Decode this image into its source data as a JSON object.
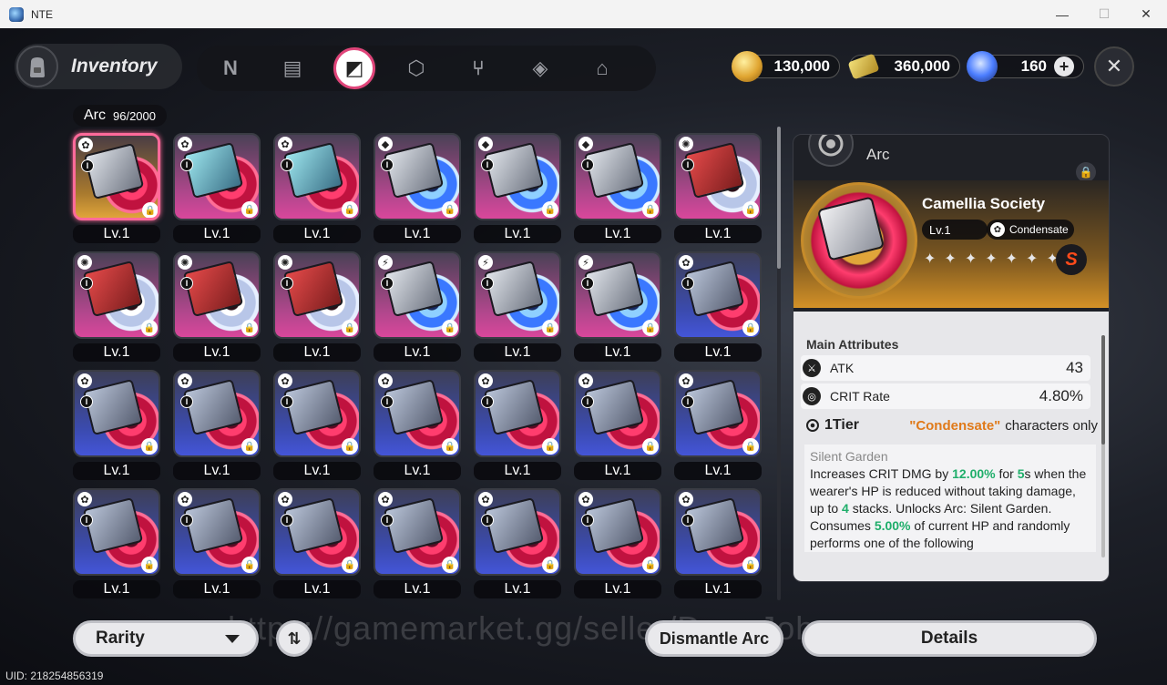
{
  "window": {
    "title": "NTE",
    "minimize": "—",
    "maximize": "☐",
    "close": "✕"
  },
  "header": {
    "inventory_label": "Inventory",
    "tabs": [
      {
        "icon": "n-logo-icon",
        "glyph": "N"
      },
      {
        "icon": "gameboy-icon",
        "glyph": "▤"
      },
      {
        "icon": "arc-cartridge-icon",
        "glyph": "◩",
        "active": true
      },
      {
        "icon": "box-icon",
        "glyph": "⬡"
      },
      {
        "icon": "fork-knife-icon",
        "glyph": "⑂"
      },
      {
        "icon": "cube-icon",
        "glyph": "◈"
      },
      {
        "icon": "house-icon",
        "glyph": "⌂"
      }
    ],
    "currencies": [
      {
        "icon": "gold-coin-icon",
        "value": "130,000",
        "color": "#e0a531"
      },
      {
        "icon": "ticket-icon",
        "value": "360,000",
        "color": "#d8c24a"
      },
      {
        "icon": "crystal-icon",
        "value": "160",
        "color": "#4b7dff",
        "plus": "+"
      }
    ],
    "close_glyph": "✕"
  },
  "arc_count": {
    "label": "Arc",
    "count": "96/2000"
  },
  "grid": {
    "level_text": "Lv.1",
    "tier_mark": "I",
    "rows": [
      [
        {
          "style": "gold",
          "cart": "silver",
          "disc": "",
          "badge": "✿",
          "selected": true
        },
        {
          "style": "pink",
          "cart": "teal",
          "disc": "",
          "badge": "✿"
        },
        {
          "style": "pink",
          "cart": "teal",
          "disc": "",
          "badge": "✿"
        },
        {
          "style": "pink",
          "cart": "silver",
          "disc": "blueglow",
          "badge": "◆"
        },
        {
          "style": "pink",
          "cart": "silver",
          "disc": "blueglow",
          "badge": "◆"
        },
        {
          "style": "pink",
          "cart": "silver",
          "disc": "blueglow",
          "badge": "◆"
        },
        {
          "style": "pink",
          "cart": "red",
          "disc": "swirl",
          "badge": "✺"
        }
      ],
      [
        {
          "style": "pink",
          "cart": "red",
          "disc": "swirl",
          "badge": "✺"
        },
        {
          "style": "pink",
          "cart": "red",
          "disc": "swirl",
          "badge": "✺"
        },
        {
          "style": "pink",
          "cart": "red",
          "disc": "swirl",
          "badge": "✺"
        },
        {
          "style": "pink",
          "cart": "silver",
          "disc": "blueglow",
          "badge": "⚡"
        },
        {
          "style": "pink",
          "cart": "silver",
          "disc": "blueglow",
          "badge": "⚡"
        },
        {
          "style": "pink",
          "cart": "silver",
          "disc": "blueglow",
          "badge": "⚡"
        },
        {
          "style": "blue",
          "cart": "gray",
          "disc": "",
          "badge": "✿"
        }
      ],
      [
        {
          "style": "blue",
          "cart": "gray",
          "disc": "",
          "badge": "✿"
        },
        {
          "style": "blue",
          "cart": "gray",
          "disc": "",
          "badge": "✿"
        },
        {
          "style": "blue",
          "cart": "gray",
          "disc": "",
          "badge": "✿"
        },
        {
          "style": "blue",
          "cart": "gray",
          "disc": "",
          "badge": "✿"
        },
        {
          "style": "blue",
          "cart": "gray",
          "disc": "",
          "badge": "✿"
        },
        {
          "style": "blue",
          "cart": "gray",
          "disc": "",
          "badge": "✿"
        },
        {
          "style": "blue",
          "cart": "gray",
          "disc": "",
          "badge": "✿"
        }
      ],
      [
        {
          "style": "blue",
          "cart": "gray",
          "disc": "",
          "badge": "✿"
        },
        {
          "style": "blue",
          "cart": "gray",
          "disc": "",
          "badge": "✿"
        },
        {
          "style": "blue",
          "cart": "gray",
          "disc": "",
          "badge": "✿"
        },
        {
          "style": "blue",
          "cart": "gray",
          "disc": "",
          "badge": "✿"
        },
        {
          "style": "blue",
          "cart": "gray",
          "disc": "",
          "badge": "✿"
        },
        {
          "style": "blue",
          "cart": "gray",
          "disc": "",
          "badge": "✿"
        },
        {
          "style": "blue",
          "cart": "gray",
          "disc": "",
          "badge": "✿"
        }
      ]
    ]
  },
  "detail": {
    "type_label": "Arc",
    "item_name": "Camellia Society",
    "level": "Lv.1",
    "tag": "Condensate",
    "stars": [
      "✦",
      "✦",
      "✦",
      "✦",
      "✦",
      "✦",
      "✦"
    ],
    "faction_logo": "S",
    "main_attributes_title": "Main Attributes",
    "attributes": [
      {
        "icon": "sword-icon",
        "name": "ATK",
        "value": "43"
      },
      {
        "icon": "crosshair-icon",
        "name": "CRIT Rate",
        "value": "4.80%"
      }
    ],
    "tier_label": "1Tier",
    "tier_condition": "\"Condensate\"",
    "tier_condition_suffix": "characters only",
    "effect_name": "Silent Garden",
    "effect_text_1": "Increases CRIT DMG by ",
    "effect_hl_1": "12.00%",
    "effect_text_2": " for ",
    "effect_hl_2": "5",
    "effect_text_3": "s when the wearer's HP is reduced without taking damage, up to ",
    "effect_hl_3": "4",
    "effect_text_4": " stacks. Unlocks Arc: Silent Garden.",
    "effect_text_5": "Consumes ",
    "effect_hl_5": "5.00%",
    "effect_text_6": " of current HP and randomly performs one of the following"
  },
  "bottom": {
    "rarity_label": "Rarity",
    "sort_glyph": "⇅",
    "dismantle_label": "Dismantle Arc",
    "details_label": "Details",
    "watermark": "https://gamemarket.gg/seller/DangJohn"
  },
  "uid": "UID: 218254856319"
}
